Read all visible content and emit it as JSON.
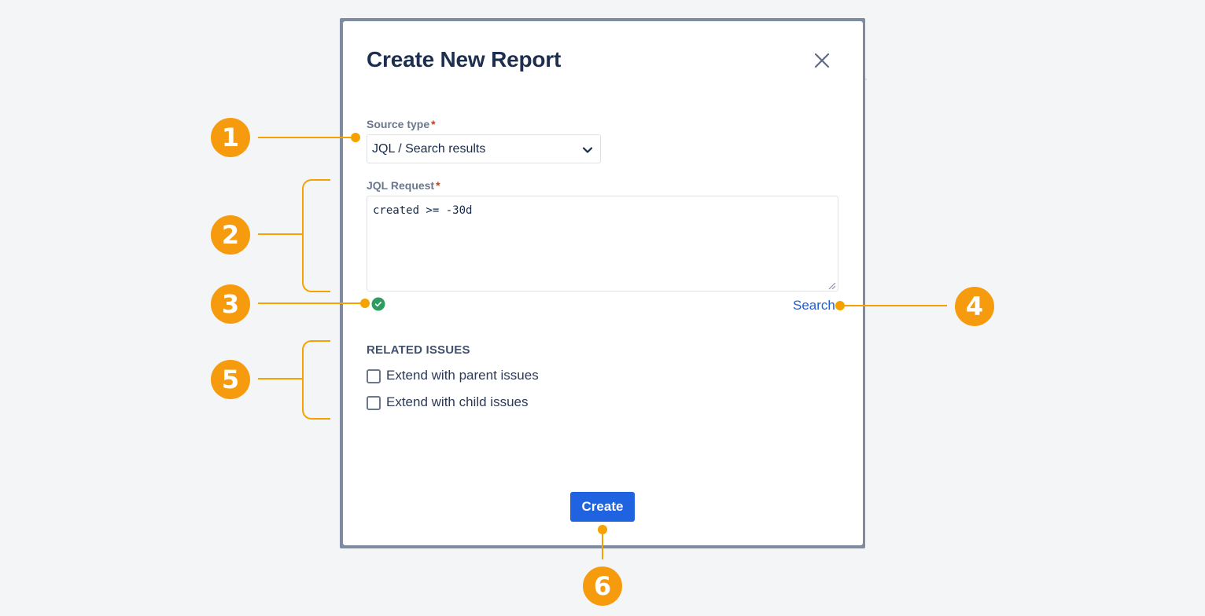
{
  "dialog": {
    "title": "Create New Report",
    "close_icon": "close-icon",
    "source_type": {
      "label": "Source type",
      "required_mark": "*",
      "value": "JQL / Search results",
      "dropdown_icon": "chevron-down-icon"
    },
    "jql_request": {
      "label": "JQL Request",
      "required_mark": "*",
      "value": "created >= -30d",
      "status_icon": "check-circle-icon",
      "status_color": "#2e9b63"
    },
    "search_link": "Search",
    "related_issues": {
      "title": "RELATED ISSUES",
      "options": [
        {
          "label": "Extend with parent issues",
          "checked": false
        },
        {
          "label": "Extend with child issues",
          "checked": false
        }
      ]
    },
    "create_button": "Create"
  },
  "annotations": {
    "color": "#f79b0e",
    "badges": [
      "1",
      "2",
      "3",
      "4",
      "5",
      "6"
    ]
  },
  "colors": {
    "primary_button": "#1f63e0",
    "link": "#1f5fd1",
    "required": "#de350b"
  }
}
